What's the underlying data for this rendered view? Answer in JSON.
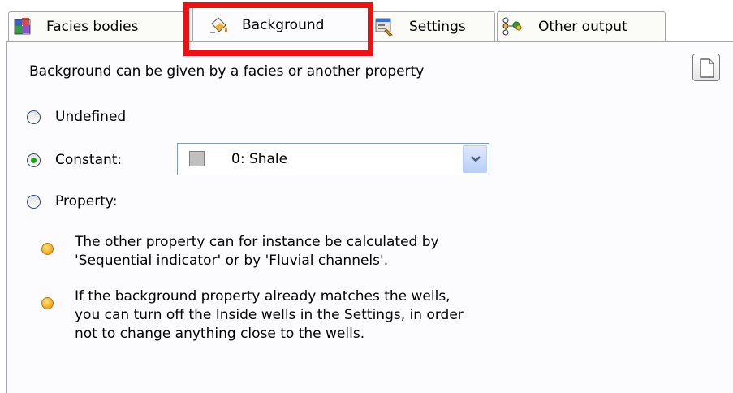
{
  "tabs": [
    {
      "label": "Facies bodies",
      "icon": "facies-bodies-icon"
    },
    {
      "label": "Background",
      "icon": "paint-bucket-icon",
      "active": true
    },
    {
      "label": "Settings",
      "icon": "settings-icon"
    },
    {
      "label": "Other output",
      "icon": "other-output-icon"
    }
  ],
  "colors": {
    "highlight_box": "#ee1111",
    "active_tab_accent": "#f2b132",
    "radio_dot": "#21a121",
    "bullet": "#f2a51a"
  },
  "panel": {
    "description": "Background can be given by a facies or another property",
    "page_button_icon": "blank-page-icon",
    "options": {
      "undefined": {
        "label": "Undefined",
        "checked": false
      },
      "constant": {
        "label": "Constant:",
        "checked": true
      },
      "property": {
        "label": "Property:",
        "checked": false
      }
    },
    "constant_dropdown": {
      "value": "0: Shale",
      "swatch_color": "#c0c0c0"
    },
    "hints": [
      {
        "lines": [
          "The other property can for instance be calculated by",
          "'Sequential indicator' or by 'Fluvial channels'."
        ]
      },
      {
        "lines": [
          "If the background property already matches the wells,",
          "you can turn off the Inside wells in the Settings, in order",
          "not to change anything close to the wells."
        ]
      }
    ]
  }
}
